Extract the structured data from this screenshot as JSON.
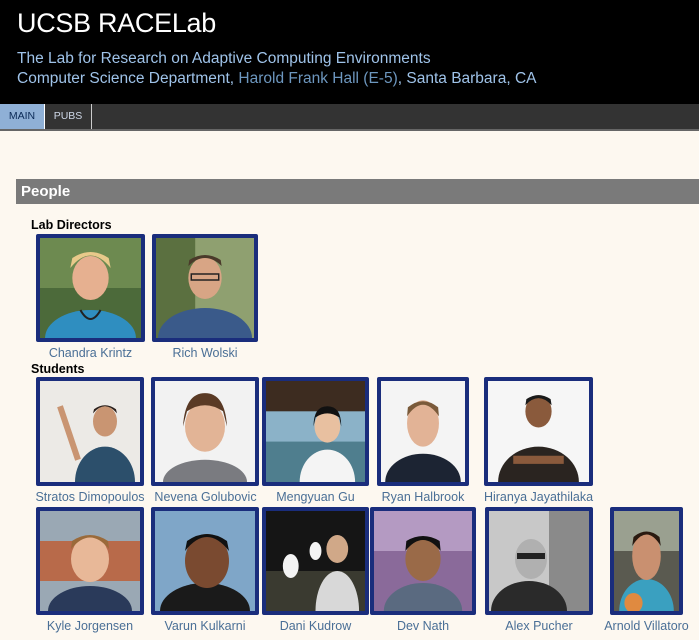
{
  "header": {
    "title": "UCSB RACELab",
    "subtitle": "The Lab for Research on Adaptive Computing Environments",
    "address_prefix": "Computer Science Department, ",
    "address_building": "Harold Frank Hall (E-5)",
    "address_suffix": ", Santa Barbara, CA"
  },
  "nav": {
    "tabs": [
      {
        "label": "MAIN"
      },
      {
        "label": "PUBS"
      }
    ]
  },
  "section": {
    "title": "People"
  },
  "groups": {
    "directors_label": "Lab Directors",
    "students_label": "Students"
  },
  "people": {
    "directors": [
      "Chandra Krintz",
      "Rich Wolski"
    ],
    "students_row1": [
      "Stratos Dimopoulos",
      "Nevena Golubovic",
      "Mengyuan Gu",
      "Ryan Halbrook",
      "Hiranya Jayathilaka"
    ],
    "students_row2": [
      "Kyle Jorgensen",
      "Varun Kulkarni",
      "Dani Kudrow",
      "Dev Nath",
      "Alex Pucher",
      "Arnold Villatoro"
    ]
  },
  "colors": {
    "photo_border": "#1a2d7c",
    "link": "#4a6f96",
    "header_text": "#9fc3e9"
  }
}
